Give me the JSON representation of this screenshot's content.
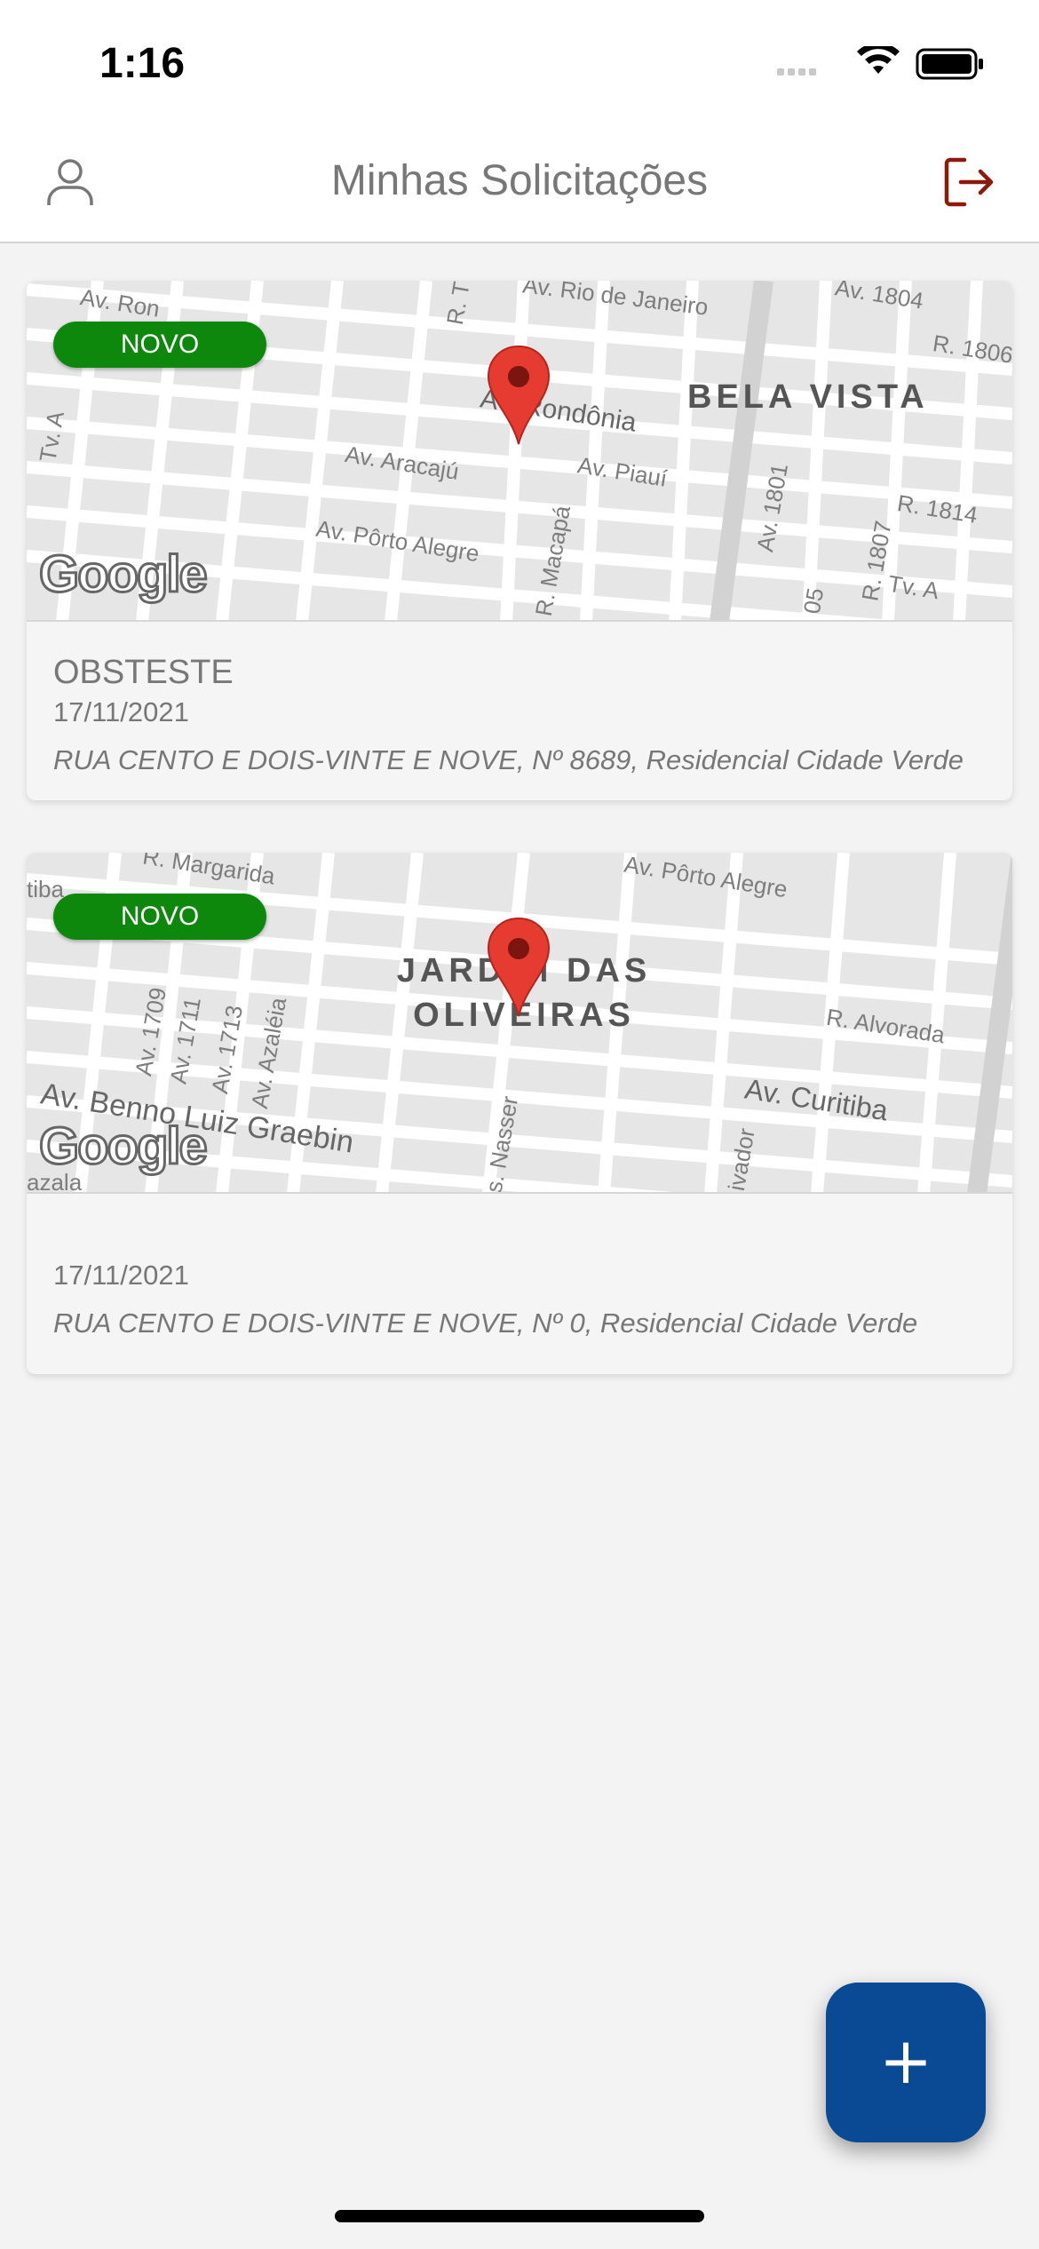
{
  "status_bar": {
    "time": "1:16"
  },
  "header": {
    "title": "Minhas Solicitações",
    "profile_icon": "person-icon",
    "logout_icon": "logout-icon",
    "logout_color": "#8b1a0a"
  },
  "requests": [
    {
      "status": "NOVO",
      "title": "OBSTESTE",
      "date": "17/11/2021",
      "address": "RUA CENTO E DOIS-VINTE E NOVE, Nº 8689, Residencial Cidade Verde",
      "map": {
        "area_label": "BELA VISTA",
        "streets": [
          "Av. Rio de Janeiro",
          "Av. Rondônia",
          "Av. Aracajú",
          "Av. Piauí",
          "Av. Pôrto Alegre",
          "R. Macapá",
          "Av. 1801",
          "R. 1807",
          "R. 1814",
          "R. 1806",
          "Av. 1804",
          "Tv. A",
          "Tv. A",
          "Av. Ron",
          "R. T",
          "05"
        ],
        "attribution": "Google"
      }
    },
    {
      "status": "NOVO",
      "title": "",
      "date": "17/11/2021",
      "address": "RUA CENTO E DOIS-VINTE E NOVE, Nº 0, Residencial Cidade Verde",
      "map": {
        "area_label_line1": "JARDIM DAS",
        "area_label_line2": "OLIVEIRAS",
        "streets": [
          "R. Margarida",
          "Av. Pôrto Alegre",
          "Av. 1709",
          "Av. 1711",
          "Av. 1713",
          "Av. Azaléia",
          "Av. Benno Luiz Graebin",
          "Av. Curitiba",
          "R. Alvorada",
          "es. Nasser",
          "ivador",
          "azala",
          "tiba"
        ],
        "attribution": "Google"
      }
    }
  ],
  "fab": {
    "label": "+",
    "color": "#0a4a94"
  },
  "colors": {
    "badge_green": "#0d880d",
    "pin_red": "#e53b30",
    "background": "#f3f3f3"
  }
}
